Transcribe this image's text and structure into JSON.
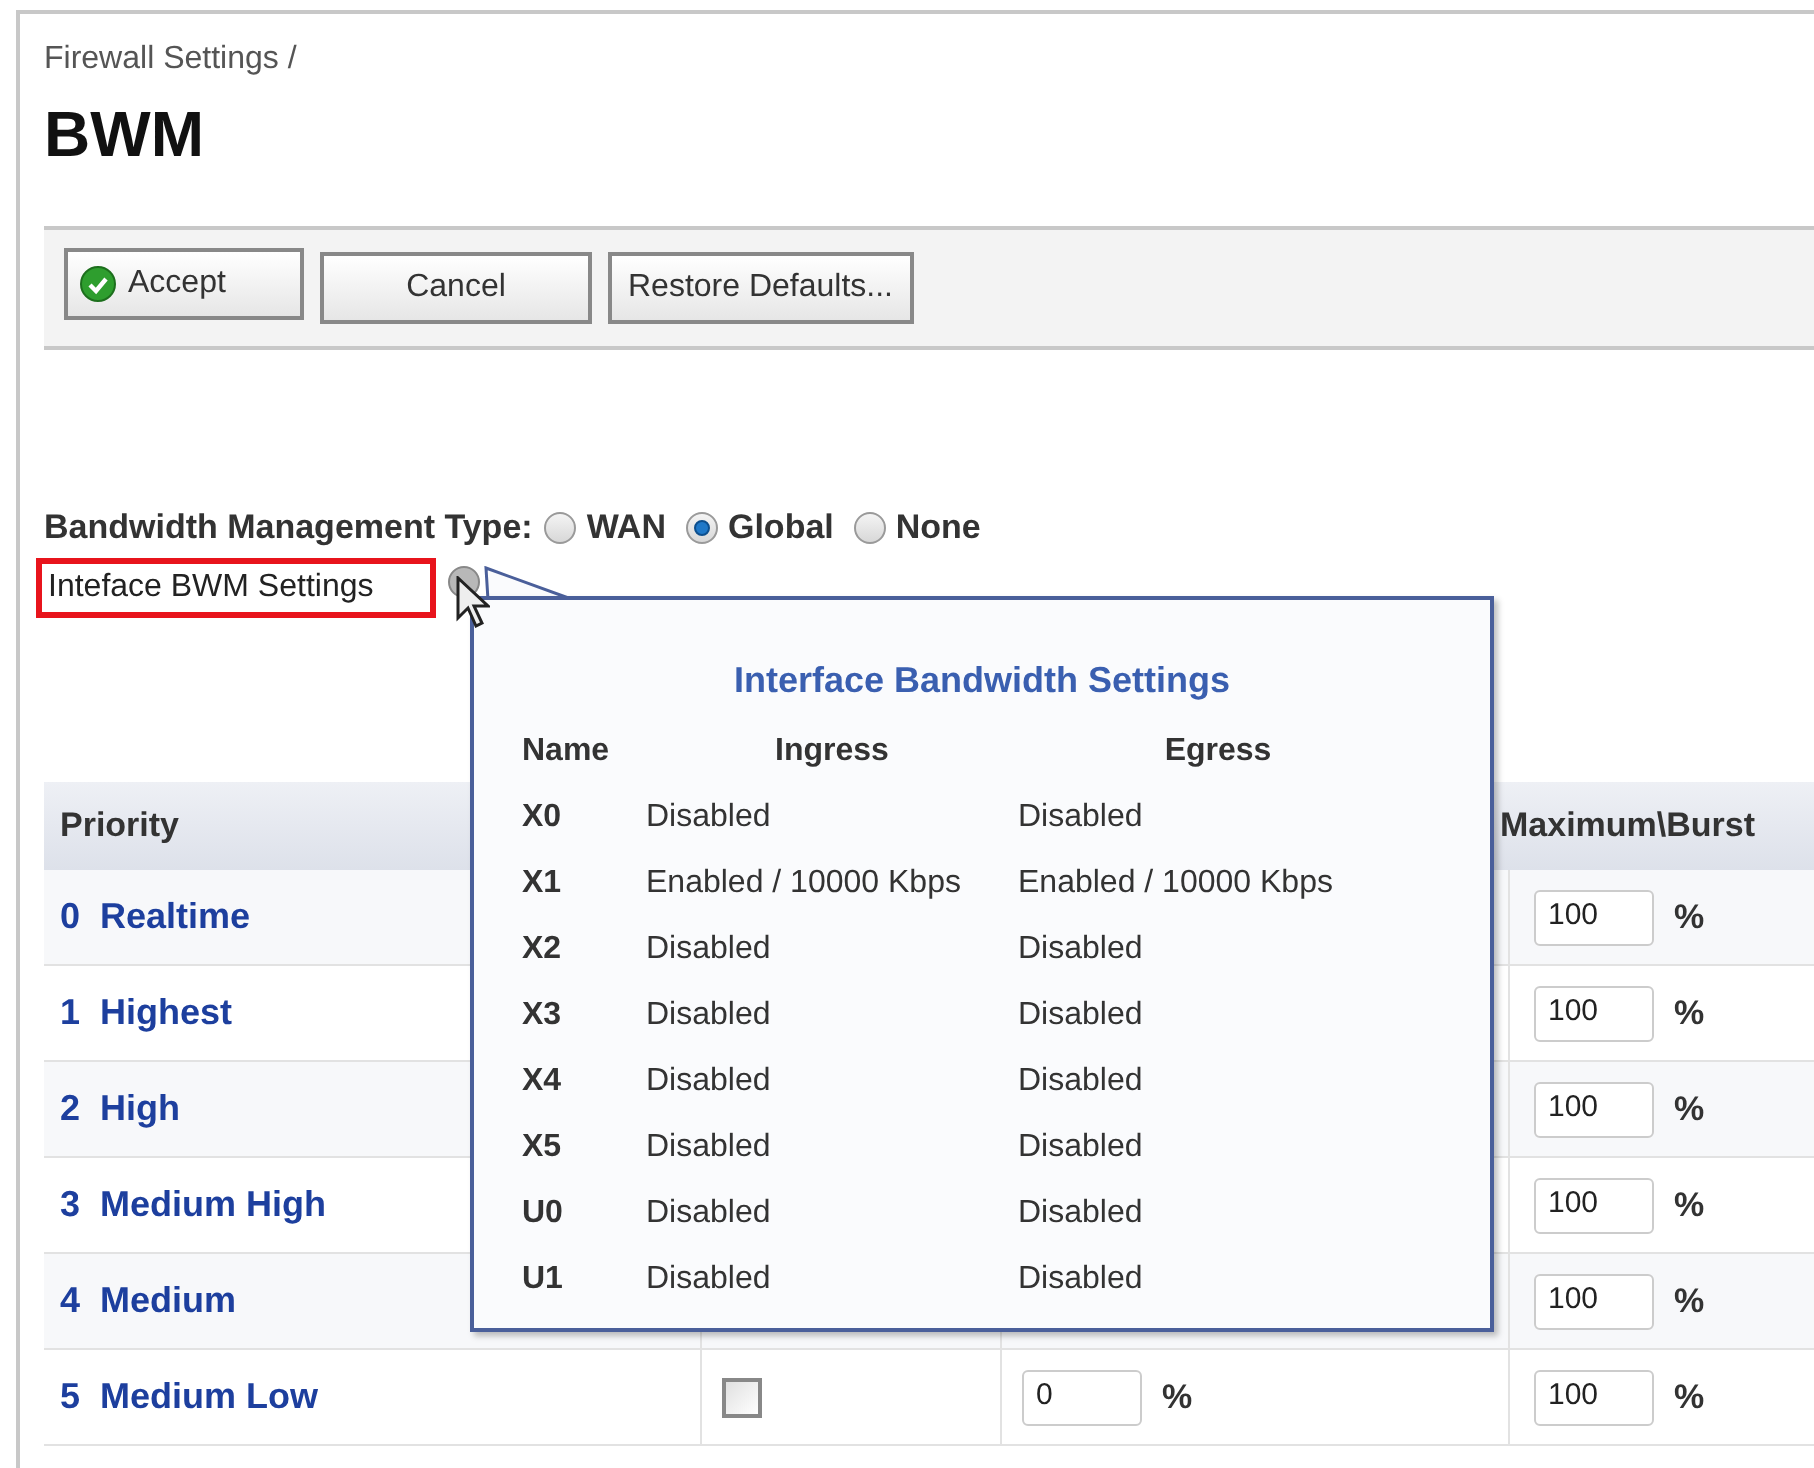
{
  "breadcrumb": "Firewall Settings /",
  "title": "BWM",
  "toolbar": [
    {
      "label": "Accept",
      "kind": "accept"
    },
    {
      "label": "Cancel",
      "kind": "plain"
    },
    {
      "label": "Restore Defaults...",
      "kind": "plain"
    }
  ],
  "bandwidth_management_type": {
    "label": "Bandwidth Management Type:",
    "options": [
      {
        "label": "WAN",
        "selected": false
      },
      {
        "label": "Global",
        "selected": true
      },
      {
        "label": "None",
        "selected": false
      }
    ]
  },
  "interface_link": {
    "label": "Inteface BWM Settings",
    "highlighted": true
  },
  "tooltip": {
    "title": "Interface Bandwidth Settings",
    "columns": [
      "Name",
      "Ingress",
      "Egress"
    ],
    "rows": [
      {
        "name": "X0",
        "ingress": "Disabled",
        "egress": "Disabled"
      },
      {
        "name": "X1",
        "ingress": "Enabled / 10000 Kbps",
        "egress": "Enabled / 10000 Kbps"
      },
      {
        "name": "X2",
        "ingress": "Disabled",
        "egress": "Disabled"
      },
      {
        "name": "X3",
        "ingress": "Disabled",
        "egress": "Disabled"
      },
      {
        "name": "X4",
        "ingress": "Disabled",
        "egress": "Disabled"
      },
      {
        "name": "X5",
        "ingress": "Disabled",
        "egress": "Disabled"
      },
      {
        "name": "U0",
        "ingress": "Disabled",
        "egress": "Disabled"
      },
      {
        "name": "U1",
        "ingress": "Disabled",
        "egress": "Disabled"
      }
    ]
  },
  "table": {
    "columns": [
      "Priority",
      "Maximum\\Burst"
    ],
    "rows": [
      {
        "number": "0",
        "name": "Realtime",
        "maximum": "100",
        "maximum_unit": "%"
      },
      {
        "number": "1",
        "name": "Highest",
        "maximum": "100",
        "maximum_unit": "%"
      },
      {
        "number": "2",
        "name": "High",
        "maximum": "100",
        "maximum_unit": "%"
      },
      {
        "number": "3",
        "name": "Medium High",
        "maximum": "100",
        "maximum_unit": "%"
      },
      {
        "number": "4",
        "name": "Medium",
        "maximum": "100",
        "maximum_unit": "%"
      },
      {
        "number": "5",
        "name": "Medium Low",
        "enable": {
          "checked": false
        },
        "guaranteed": "0",
        "guaranteed_unit": "%",
        "maximum": "100",
        "maximum_unit": "%"
      }
    ]
  }
}
